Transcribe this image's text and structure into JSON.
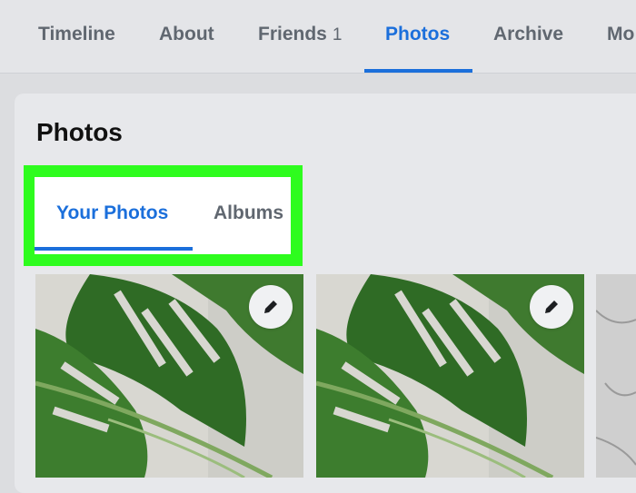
{
  "topnav": {
    "tabs": [
      {
        "label": "Timeline",
        "active": false
      },
      {
        "label": "About",
        "active": false
      },
      {
        "label": "Friends",
        "count": "1",
        "active": false
      },
      {
        "label": "Photos",
        "active": true
      },
      {
        "label": "Archive",
        "active": false
      },
      {
        "label": "Mo",
        "active": false
      }
    ]
  },
  "section": {
    "title": "Photos",
    "subtabs": [
      {
        "label": "Your Photos",
        "active": true
      },
      {
        "label": "Albums",
        "active": false
      }
    ],
    "highlight_color": "#2efc1e"
  },
  "photos": [
    {
      "icon": "pencil-icon",
      "subject": "monstera leaf"
    },
    {
      "icon": "pencil-icon",
      "subject": "monstera leaf"
    },
    {
      "subject": "marble texture (partially visible)"
    }
  ],
  "colors": {
    "accent": "#1b6fdb",
    "text_muted": "#606770"
  }
}
